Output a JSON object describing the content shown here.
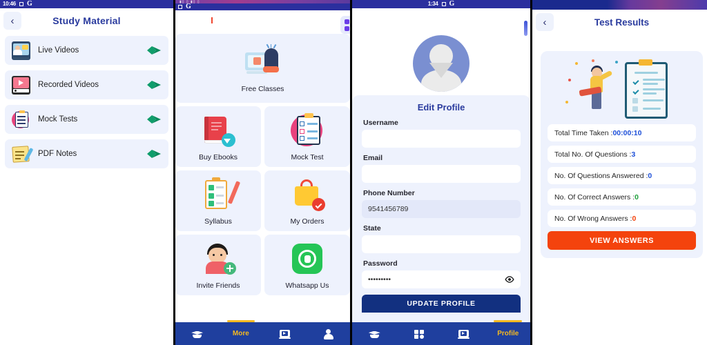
{
  "panels": {
    "study_material": {
      "status_bar": {
        "time": "10:46",
        "icons": [
          "square-icon",
          "google-icon"
        ]
      },
      "back_label": "‹",
      "title": "Study Material",
      "items": [
        {
          "label": "Live Videos",
          "icon": "live-video-icon"
        },
        {
          "label": "Recorded Videos",
          "icon": "recorded-video-icon"
        },
        {
          "label": "Mock Tests",
          "icon": "clipboard-test-icon"
        },
        {
          "label": "PDF Notes",
          "icon": "pdf-notes-icon"
        }
      ],
      "bottom_nav": []
    },
    "home_grid": {
      "status_bar": {
        "time": "",
        "icons": [
          "square-icon",
          "google-icon"
        ]
      },
      "grid_button_icon": "grid-apps-icon",
      "featured": {
        "label": "Free Classes",
        "icon": "free-classes-icon"
      },
      "tiles": [
        {
          "label": "Buy Ebooks",
          "icon": "ebook-download-icon"
        },
        {
          "label": "Mock Test",
          "icon": "mock-test-icon"
        },
        {
          "label": "Syllabus",
          "icon": "syllabus-icon"
        },
        {
          "label": "My Orders",
          "icon": "orders-bag-icon"
        },
        {
          "label": "Invite Friends",
          "icon": "invite-friend-icon"
        },
        {
          "label": "Whatsapp Us",
          "icon": "whatsapp-icon"
        }
      ],
      "bottom_nav": [
        {
          "label": "",
          "icon": "graduation-cap-icon",
          "active": false
        },
        {
          "label": "More",
          "icon": "",
          "active": true
        },
        {
          "label": "",
          "icon": "video-icon",
          "active": false
        },
        {
          "label": "",
          "icon": "person-icon",
          "active": false
        }
      ]
    },
    "edit_profile": {
      "status_bar": {
        "time": "1:34",
        "icons": [
          "square-icon",
          "google-icon"
        ]
      },
      "avatar_icon": "default-avatar-icon",
      "title": "Edit Profile",
      "fields": [
        {
          "label": "Username",
          "value": "",
          "placeholder": "",
          "type": "text",
          "filled": false
        },
        {
          "label": "Email",
          "value": "",
          "placeholder": "",
          "type": "email",
          "filled": false
        },
        {
          "label": "Phone Number",
          "value": "9541456789",
          "placeholder": "",
          "type": "tel",
          "filled": true
        },
        {
          "label": "State",
          "value": "",
          "placeholder": "",
          "type": "text",
          "filled": false
        },
        {
          "label": "Password",
          "value": "•••••••••",
          "placeholder": "",
          "type": "password",
          "filled": false
        }
      ],
      "password_toggle_icon": "eye-icon",
      "submit_label": "UPDATE PROFILE",
      "bottom_nav": [
        {
          "label": "",
          "icon": "graduation-cap-icon",
          "active": false
        },
        {
          "label": "",
          "icon": "grid-apps-icon",
          "active": false
        },
        {
          "label": "",
          "icon": "video-icon",
          "active": false
        },
        {
          "label": "Profile",
          "icon": "",
          "active": true
        }
      ]
    },
    "test_results": {
      "back_label": "‹",
      "title": "Test Results",
      "illustration_icon": "test-result-checklist-icon",
      "rows": [
        {
          "label": "Total Time Taken : ",
          "value": "00:00:10",
          "value_color": "#1d4fd8"
        },
        {
          "label": "Total No. Of Questions : ",
          "value": "3",
          "value_color": "#1d4fd8"
        },
        {
          "label": "No. Of Questions Answered : ",
          "value": "0",
          "value_color": "#1d4fd8"
        },
        {
          "label": "No. Of Correct Answers : ",
          "value": "0",
          "value_color": "#1ea13c"
        },
        {
          "label": "No. Of Wrong Answers : ",
          "value": "0",
          "value_color": "#f4430d"
        }
      ],
      "view_answers_label": "VIEW ANSWERS"
    }
  },
  "colors": {
    "brand_blue": "#2a3b9e",
    "nav_blue": "#1f3f9e",
    "card_bg": "#eef2fd",
    "accent_orange": "#f4430d",
    "accent_yellow": "#f5b921",
    "status_bar": "#2b2f9e",
    "update_btn": "#123080"
  }
}
